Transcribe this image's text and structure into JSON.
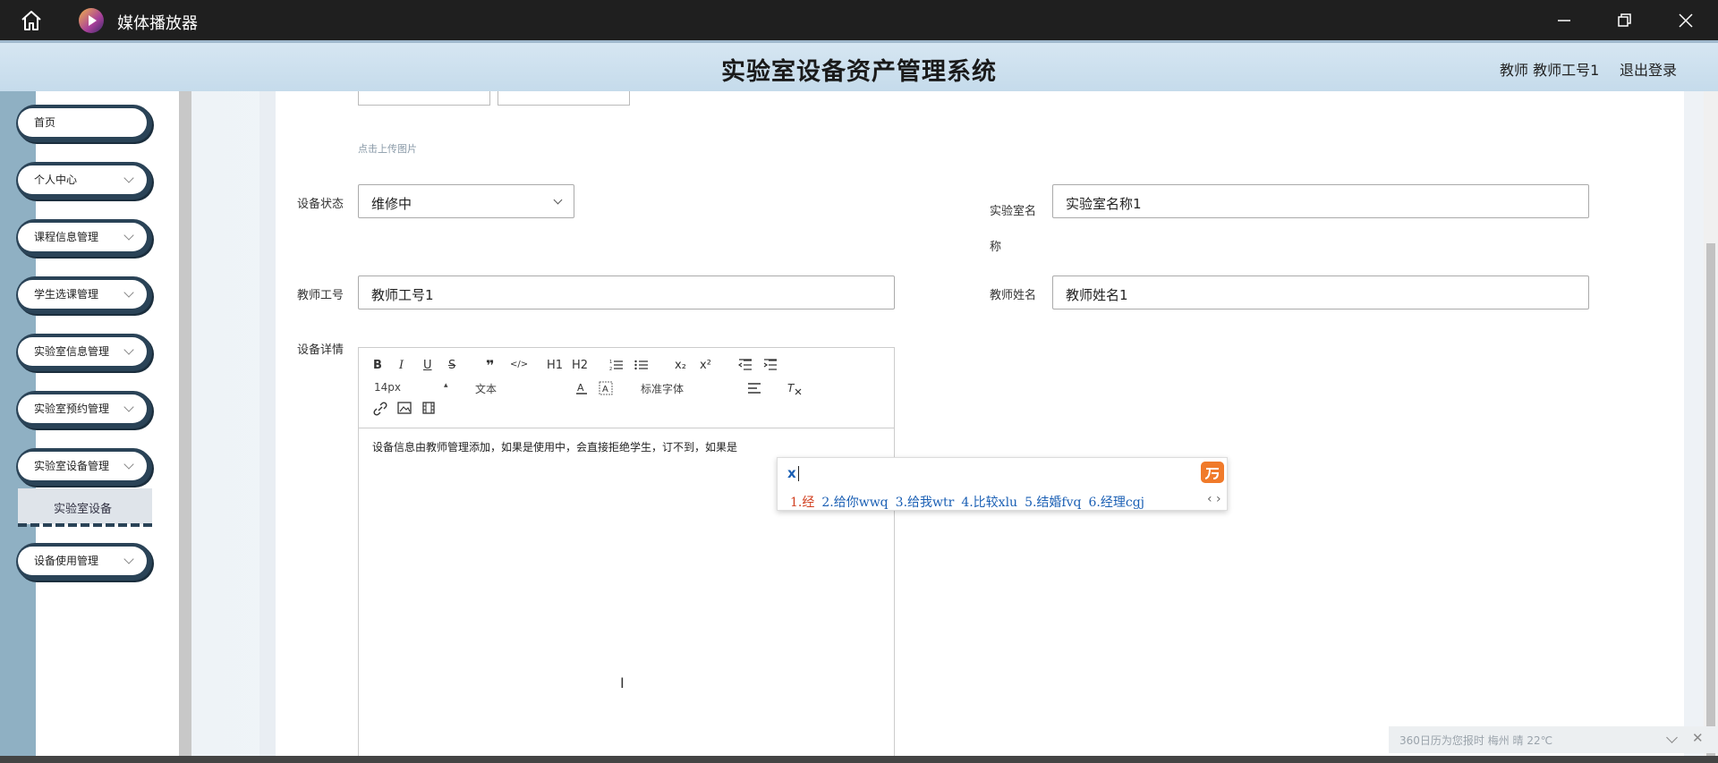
{
  "window": {
    "app_title": "媒体播放器",
    "icons": {
      "home": "home-icon",
      "app": "media-player-icon",
      "minimize": "minimize-icon",
      "maximize": "restore-icon",
      "close": "close-icon"
    }
  },
  "header": {
    "system_title": "实验室设备资产管理系统",
    "user_info": "教师 教师工号1",
    "logout": "退出登录"
  },
  "sidebar": {
    "items": [
      {
        "label": "首页",
        "expandable": false
      },
      {
        "label": "个人中心",
        "expandable": true
      },
      {
        "label": "课程信息管理",
        "expandable": true
      },
      {
        "label": "学生选课管理",
        "expandable": true
      },
      {
        "label": "实验室信息管理",
        "expandable": true
      },
      {
        "label": "实验室预约管理",
        "expandable": true
      },
      {
        "label": "实验室设备管理",
        "expandable": true
      },
      {
        "label": "设备使用管理",
        "expandable": true
      }
    ],
    "active_sub_item": "实验室设备"
  },
  "form": {
    "upload_hint": "点击上传图片",
    "status_label": "设备状态",
    "status_value": "维修中",
    "lab_name_label": "实验室名称",
    "lab_name_value": "实验室名称1",
    "teacher_id_label": "教师工号",
    "teacher_id_value": "教师工号1",
    "teacher_name_label": "教师姓名",
    "teacher_name_value": "教师姓名1",
    "detail_label": "设备详情"
  },
  "editor": {
    "toolbar_row1": [
      "B",
      "I",
      "U",
      "S",
      "❞",
      "</>",
      "H1",
      "H2",
      "ol",
      "ul",
      "x₂",
      "x²",
      "outdent",
      "indent"
    ],
    "font_size": "14px",
    "block_format": "文本",
    "font_family": "标准字体",
    "content": "设备信息由教师管理添加，如果是使用中，会直接拒绝学生，订不到，如果是"
  },
  "ime": {
    "input": "x",
    "candidates": [
      "1.经",
      "2.给你wwq",
      "3.给我wtr",
      "4.比较xlu",
      "5.结婚fvq",
      "6.经理cgj"
    ]
  },
  "notification": {
    "text": "360日历为您报时 梅州 晴 22℃"
  }
}
